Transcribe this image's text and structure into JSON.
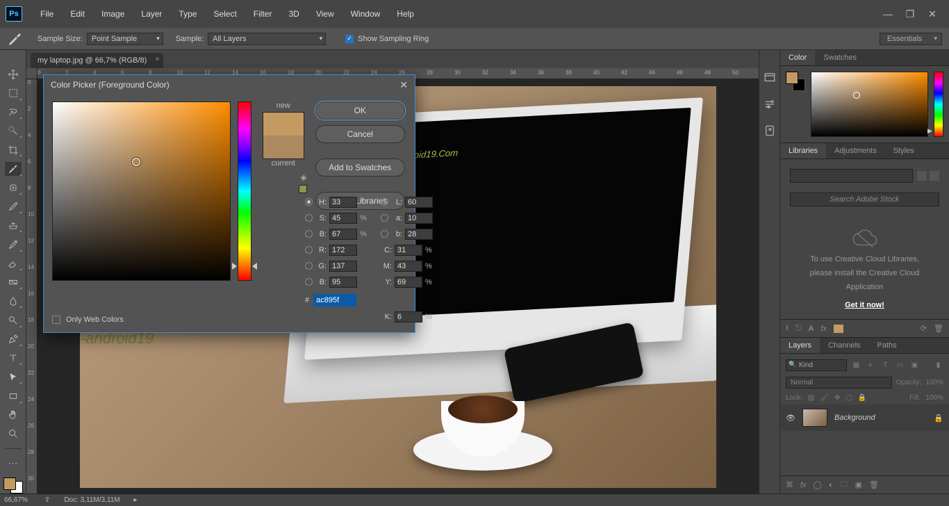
{
  "app": {
    "logo": "Ps"
  },
  "menu": [
    "File",
    "Edit",
    "Image",
    "Layer",
    "Type",
    "Select",
    "Filter",
    "3D",
    "View",
    "Window",
    "Help"
  ],
  "workspace": "Essentials",
  "optionsbar": {
    "sample_size_label": "Sample Size:",
    "sample_size_value": "Point Sample",
    "sample_label": "Sample:",
    "sample_value": "All Layers",
    "show_sampling_ring": "Show Sampling Ring"
  },
  "document": {
    "tab_title": "my laptop.jpg @ 66,7% (RGB/8)"
  },
  "color_picker": {
    "title": "Color Picker (Foreground Color)",
    "new_label": "new",
    "current_label": "current",
    "new_color": "#c49a63",
    "current_color": "#ac895f",
    "ok": "OK",
    "cancel": "Cancel",
    "add_swatches": "Add to Swatches",
    "color_libraries": "Color Libraries",
    "only_web": "Only Web Colors",
    "H": "33",
    "H_unit": "°",
    "S": "45",
    "S_unit": "%",
    "Bv": "67",
    "Bv_unit": "%",
    "R": "172",
    "G": "137",
    "Bc": "95",
    "L": "60",
    "a": "10",
    "b": "28",
    "C": "31",
    "M": "43",
    "Y": "69",
    "K": "6",
    "hex": "ac895f"
  },
  "panels": {
    "color_tab": "Color",
    "swatches_tab": "Swatches",
    "libraries_tab": "Libraries",
    "adjustments_tab": "Adjustments",
    "styles_tab": "Styles",
    "search_placeholder": "Search Adobe Stock",
    "lib_msg1": "To use Creative Cloud Libraries,",
    "lib_msg2": "please install the Creative Cloud",
    "lib_msg3": "Application",
    "get_it": "Get it now!",
    "layers_tab": "Layers",
    "channels_tab": "Channels",
    "paths_tab": "Paths",
    "kind": "Kind",
    "blend": "Normal",
    "opacity_label": "Opacity:",
    "opacity_val": "100%",
    "lock_label": "Lock:",
    "fill_label": "Fill:",
    "fill_val": "100%",
    "layer_name": "Background"
  },
  "status": {
    "zoom": "66,67%",
    "doc_size": "Doc:   3,11M/3,11M"
  },
  "ruler_h": [
    "0",
    "2",
    "4",
    "6",
    "8",
    "10",
    "12",
    "14",
    "16",
    "18",
    "20",
    "22",
    "24",
    "26",
    "28",
    "30",
    "32",
    "34",
    "36",
    "38",
    "40",
    "42",
    "44",
    "46",
    "48",
    "50"
  ],
  "ruler_v": [
    "0",
    "2",
    "4",
    "6",
    "8",
    "10",
    "12",
    "14",
    "16",
    "18",
    "20",
    "22",
    "24",
    "26",
    "28",
    "30"
  ]
}
